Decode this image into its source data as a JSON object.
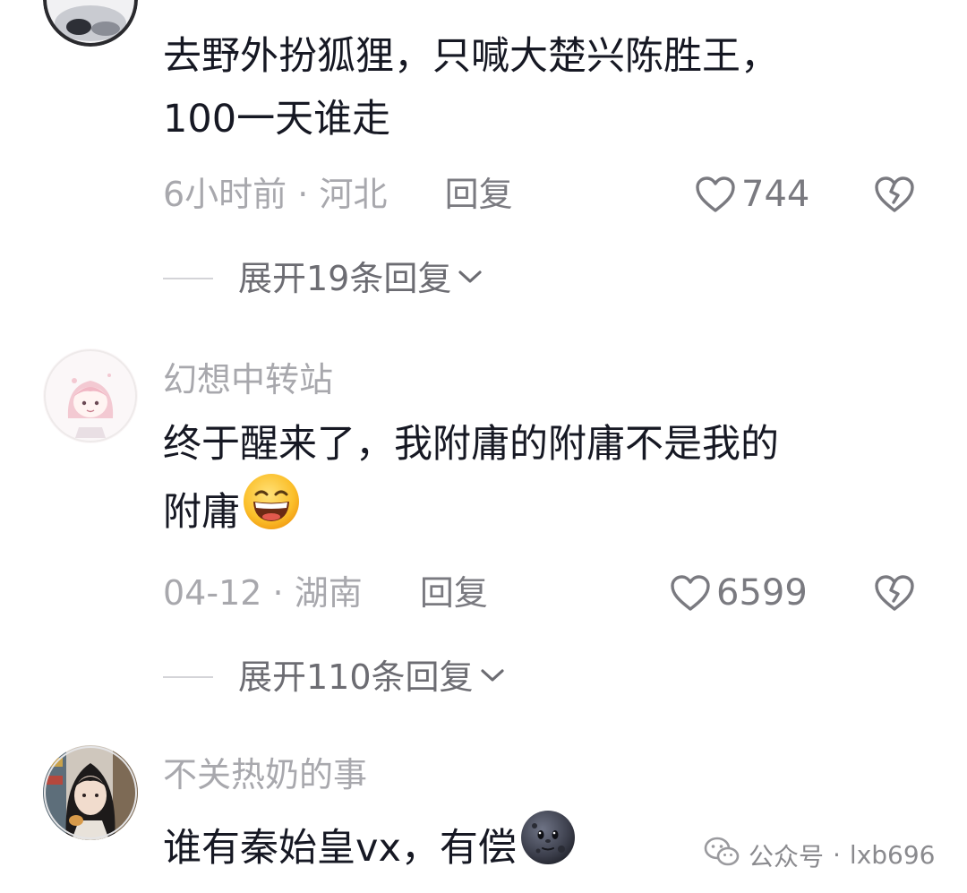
{
  "comments": [
    {
      "username": "",
      "text_line1": "去野外扮狐狸，只喊大楚兴陈胜王，",
      "text_line2": "100一天谁走",
      "time": "6小时前",
      "location": "河北",
      "separator": "·",
      "reply_label": "回复",
      "likes": "744",
      "expand_label": "展开19条回复"
    },
    {
      "username": "幻想中转站",
      "text_line1": "终于醒来了，我附庸的附庸不是我的",
      "text_line2": "附庸",
      "emoji": "grinning-face-emoji",
      "time": "04-12",
      "location": "湖南",
      "separator": "·",
      "reply_label": "回复",
      "likes": "6599",
      "expand_label": "展开110条回复"
    },
    {
      "username": "不关热奶的事",
      "text_line1": "谁有秦始皇vx，有偿",
      "emoji": "new-moon-face-emoji"
    }
  ],
  "watermark": {
    "label": "公众号",
    "separator": "·",
    "account": "lxb696",
    "icon": "wechat-icon"
  },
  "colors": {
    "text": "#161823",
    "meta": "#a8a8ad",
    "icon": "#7a7a80"
  }
}
